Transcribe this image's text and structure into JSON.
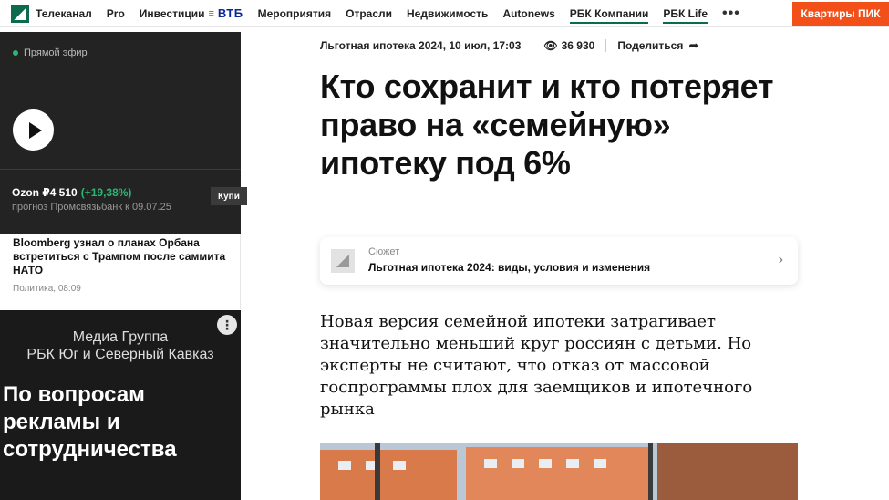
{
  "nav": {
    "items": [
      "Телеканал",
      "Pro",
      "Инвестиции",
      "Мероприятия",
      "Отрасли",
      "Недвижимость",
      "Autonews",
      "РБК Компании",
      "РБК Life"
    ],
    "vtb": "ВТБ",
    "more": "•••",
    "cta": "Квартиры ПИК"
  },
  "live": {
    "label": "Прямой эфир",
    "stock_name": "Ozon ₽4 510",
    "stock_change": "(+19,38%)",
    "forecast": "прогноз Промсвязьбанк к 09.07.25",
    "buy": "Купи"
  },
  "sidebar_news": {
    "title": "Bloomberg узнал о планах Орбана встретиться с Трампом после саммита НАТО",
    "meta": "Политика, 08:09"
  },
  "ad": {
    "top": "Медиа Группа\nРБК Юг и Северный Кавказ",
    "big": "По вопросам рекламы и сотрудничества",
    "kebab": "⋮"
  },
  "article": {
    "meta_text": "Льготная ипотека 2024, 10 июл, 17:03",
    "views": "36 930",
    "share": "Поделиться",
    "headline": "Кто сохранит и кто потеряет право на «семейную» ипотеку под 6%",
    "story_kicker": "Сюжет",
    "story_title": "Льготная ипотека 2024: виды, условия и изменения",
    "lead": "Новая версия семейной ипотеки затрагивает значительно меньший круг россиян с детьми. Но эксперты не считают, что отказ от массовой госпрограммы плох для заемщиков и ипотечного рынка"
  },
  "colors": {
    "brand": "#0c6b4f",
    "cta": "#f24f19",
    "gain": "#2bb673"
  }
}
